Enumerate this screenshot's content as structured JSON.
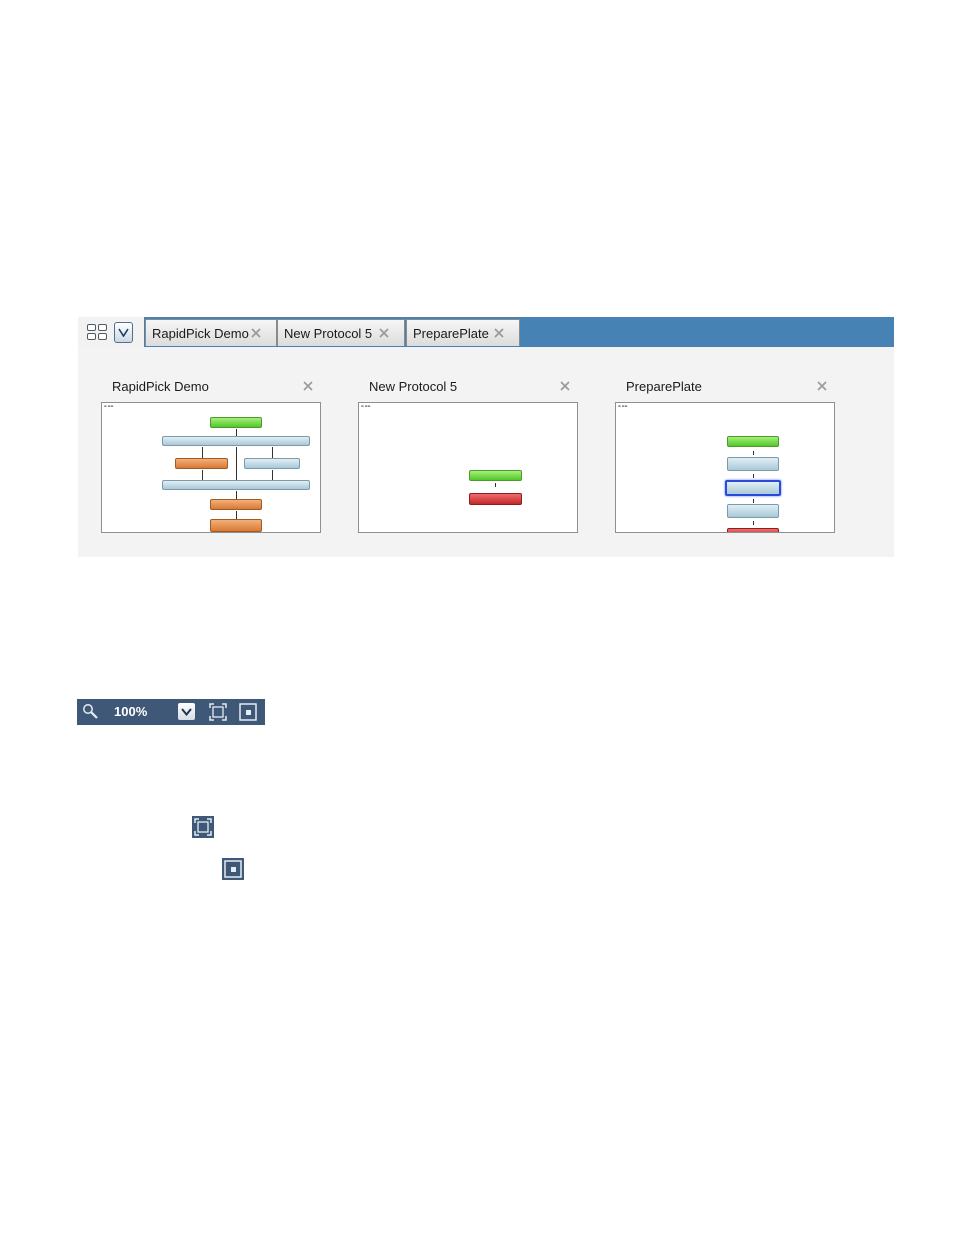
{
  "tabbar": {
    "tabs": [
      {
        "label": "RapidPick Demo"
      },
      {
        "label": "New Protocol 5"
      },
      {
        "label": "PreparePlate"
      }
    ]
  },
  "previews": [
    {
      "title": "RapidPick Demo"
    },
    {
      "title": "New Protocol 5"
    },
    {
      "title": "PreparePlate"
    }
  ],
  "zoom": {
    "value": "100%"
  },
  "colors": {
    "tab_strip": "#4682b4",
    "toolbar": "#3f5878",
    "start_node": "#52c72b",
    "step_node": "#a9c9d8",
    "device_node": "#d97a35",
    "end_node": "#c42a2a",
    "selection": "#2a4bd7"
  }
}
